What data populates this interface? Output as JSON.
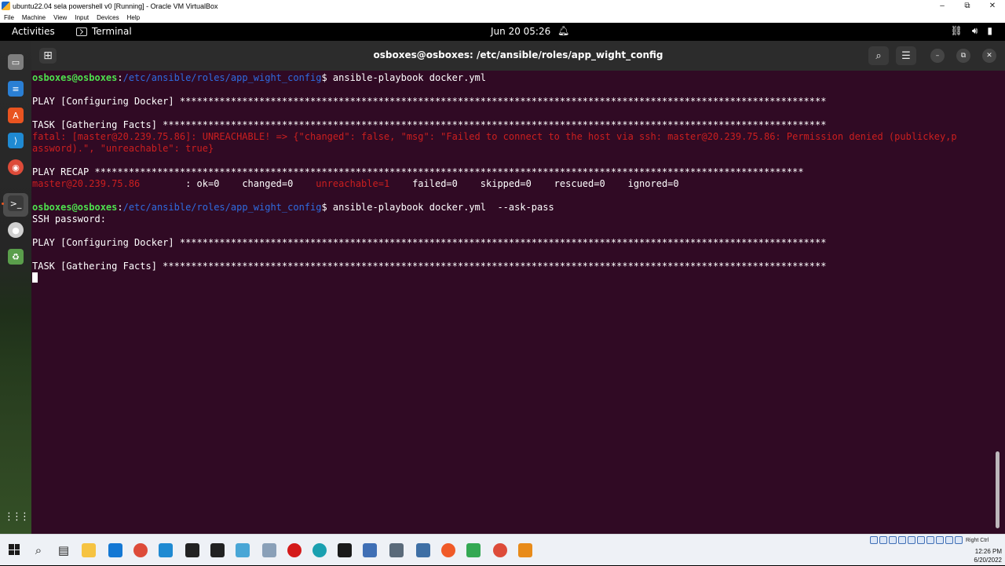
{
  "vbox": {
    "title": "ubuntu22.04 sela powershell v0 [Running] - Oracle VM VirtualBox",
    "menu": [
      "File",
      "Machine",
      "View",
      "Input",
      "Devices",
      "Help"
    ],
    "controls": {
      "minimize": "–",
      "restore": "⧉",
      "close": "✕"
    }
  },
  "topbar": {
    "activities": "Activities",
    "app_name": "Terminal",
    "clock": "Jun 20  05:26"
  },
  "terminal": {
    "title": "osboxes@osboxes: /etc/ansible/roles/app_wight_config",
    "lines": [
      [
        {
          "t": "osboxes@osboxes",
          "c": "green"
        },
        {
          "t": ":",
          "c": "white"
        },
        {
          "t": "/etc/ansible/roles/app_wight_config",
          "c": "blue"
        },
        {
          "t": "$ ansible-playbook docker.yml",
          "c": "white"
        }
      ],
      [],
      [
        {
          "t": "PLAY [Configuring Docker] ******************************************************************************************************************",
          "c": "white"
        }
      ],
      [],
      [
        {
          "t": "TASK [Gathering Facts] *********************************************************************************************************************",
          "c": "white"
        }
      ],
      [
        {
          "t": "fatal: [master@20.239.75.86]: UNREACHABLE! => {\"changed\": false, \"msg\": \"Failed to connect to the host via ssh: master@20.239.75.86: Permission denied (publickey,p",
          "c": "red"
        }
      ],
      [
        {
          "t": "assword).\", \"unreachable\": true}",
          "c": "red"
        }
      ],
      [],
      [
        {
          "t": "PLAY RECAP *****************************************************************************************************************************",
          "c": "white"
        }
      ],
      [
        {
          "t": "master@20.239.75.86",
          "c": "red"
        },
        {
          "t": "        : ok=0    changed=0    ",
          "c": "white"
        },
        {
          "t": "unreachable=1",
          "c": "red"
        },
        {
          "t": "    failed=0    skipped=0    rescued=0    ignored=0",
          "c": "white"
        }
      ],
      [],
      [
        {
          "t": "osboxes@osboxes",
          "c": "green"
        },
        {
          "t": ":",
          "c": "white"
        },
        {
          "t": "/etc/ansible/roles/app_wight_config",
          "c": "blue"
        },
        {
          "t": "$ ansible-playbook docker.yml  --ask-pass",
          "c": "white"
        }
      ],
      [
        {
          "t": "SSH password:",
          "c": "white"
        }
      ],
      [],
      [
        {
          "t": "PLAY [Configuring Docker] ******************************************************************************************************************",
          "c": "white"
        }
      ],
      [],
      [
        {
          "t": "TASK [Gathering Facts] *********************************************************************************************************************",
          "c": "white"
        }
      ],
      [
        {
          "t": "",
          "c": "white",
          "cursor": true
        }
      ]
    ]
  },
  "dock": {
    "icons": [
      {
        "name": "files-icon",
        "color": "#7e7e7e",
        "glyph": "▭"
      },
      {
        "name": "libreoffice-writer-icon",
        "color": "#2a7fd4",
        "glyph": "≡"
      },
      {
        "name": "ubuntu-software-icon",
        "color": "#e95420",
        "glyph": "A"
      },
      {
        "name": "vscode-icon",
        "color": "#1f8ad2",
        "glyph": "⟩"
      },
      {
        "name": "chrome-icon",
        "color": "#dd4b39",
        "glyph": "◉"
      },
      {
        "name": "terminal-icon",
        "color": "#3a3a3a",
        "glyph": ">_"
      },
      {
        "name": "dvd-icon",
        "color": "#d0d0d0",
        "glyph": "●"
      },
      {
        "name": "trash-icon",
        "color": "#5a9e4b",
        "glyph": "♻"
      }
    ],
    "apps_grid": "⋮⋮⋮"
  },
  "taskbar": {
    "tray_label": "Right Ctrl",
    "time": "12:26 PM",
    "date": "6/20/2022",
    "apps": [
      {
        "name": "search-icon",
        "color": "#222222",
        "glyph": "⌕"
      },
      {
        "name": "task-view-icon",
        "color": "#222222",
        "glyph": "▤"
      },
      {
        "name": "file-explorer-icon",
        "color": "#f6c342",
        "glyph": ""
      },
      {
        "name": "mail-icon",
        "color": "#1478d4",
        "glyph": ""
      },
      {
        "name": "chrome-icon",
        "color": "#dd4b39",
        "glyph": ""
      },
      {
        "name": "vscode-icon",
        "color": "#1f8ad2",
        "glyph": ""
      },
      {
        "name": "unknown-app-icon",
        "color": "#222222",
        "glyph": ""
      },
      {
        "name": "sticky-notes-icon",
        "color": "#222222",
        "glyph": ""
      },
      {
        "name": "photos-icon",
        "color": "#49a6d6",
        "glyph": ""
      },
      {
        "name": "paint-icon",
        "color": "#8aa0b8",
        "glyph": ""
      },
      {
        "name": "opera-icon",
        "color": "#d41a1a",
        "glyph": ""
      },
      {
        "name": "edge-icon",
        "color": "#1aa0b0",
        "glyph": ""
      },
      {
        "name": "cmd-icon",
        "color": "#1a1a1a",
        "glyph": ""
      },
      {
        "name": "virtualbox-icon",
        "color": "#3f6fb5",
        "glyph": ""
      },
      {
        "name": "calculator-icon",
        "color": "#5a6a7a",
        "glyph": ""
      },
      {
        "name": "network-app-icon",
        "color": "#3e6fa5",
        "glyph": ""
      },
      {
        "name": "brave-icon",
        "color": "#f05a28",
        "glyph": ""
      },
      {
        "name": "google-drive-icon",
        "color": "#34a853",
        "glyph": ""
      },
      {
        "name": "chrome-2-icon",
        "color": "#dd4b39",
        "glyph": ""
      },
      {
        "name": "sublime-icon",
        "color": "#e88b1a",
        "glyph": ""
      }
    ]
  }
}
